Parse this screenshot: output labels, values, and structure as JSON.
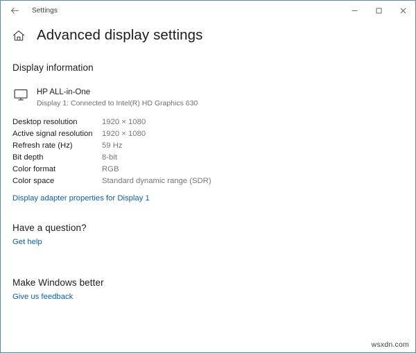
{
  "window": {
    "app_title": "Settings",
    "back_icon": "back-arrow-icon",
    "caption": {
      "minimize_label": "Minimize",
      "maximize_label": "Maximize",
      "close_label": "Close"
    }
  },
  "page": {
    "home_icon": "home-icon",
    "title": "Advanced display settings"
  },
  "sections": {
    "display_information": {
      "heading": "Display information",
      "monitor_icon": "monitor-icon",
      "monitor_name": "HP ALL-in-One",
      "monitor_connection": "Display 1: Connected to Intel(R) HD Graphics 630",
      "specs": [
        {
          "label": "Desktop resolution",
          "value": "1920 × 1080"
        },
        {
          "label": "Active signal resolution",
          "value": "1920 × 1080"
        },
        {
          "label": "Refresh rate (Hz)",
          "value": "59 Hz"
        },
        {
          "label": "Bit depth",
          "value": "8-bit"
        },
        {
          "label": "Color format",
          "value": "RGB"
        },
        {
          "label": "Color space",
          "value": "Standard dynamic range (SDR)"
        }
      ],
      "adapter_link": "Display adapter properties for Display 1"
    },
    "have_a_question": {
      "heading": "Have a question?",
      "link": "Get help"
    },
    "make_windows_better": {
      "heading": "Make Windows better",
      "link": "Give us feedback"
    }
  },
  "watermark": "wsxdn.com",
  "colors": {
    "link": "#0a60ab",
    "text_primary": "#1b1b1b",
    "text_secondary": "#767676",
    "window_border": "#5b8aa8",
    "background": "#ffffff"
  }
}
